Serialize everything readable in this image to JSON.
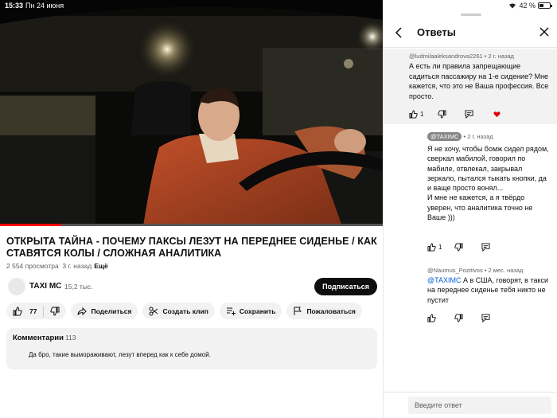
{
  "status": {
    "time": "15:33",
    "date": "Пн 24 июня",
    "battery_text": "42 %",
    "battery_level": 0.42
  },
  "video": {
    "progress": 0.16,
    "title": "ОТКРЫТА ТАЙНА - ПОЧЕМУ ПАКСЫ ЛЕЗУТ НА ПЕРЕДНЕЕ СИДЕНЬЕ / КАК СТАВЯТСЯ КОЛЫ / СЛОЖНАЯ АНАЛИТИКА",
    "views": "2 554 просмотра",
    "age": "3 г. назад",
    "more": "Ещё"
  },
  "channel": {
    "name": "TAXI MC",
    "subscribers": "15,2 тыс.",
    "subscribe_label": "Подписаться"
  },
  "actions": {
    "likes": "77",
    "share": "Поделиться",
    "clip": "Создать клип",
    "save": "Сохранить",
    "report": "Пожаловаться"
  },
  "comments": {
    "label": "Комментарии",
    "count": "113",
    "preview": "Да бро, такие вымораживают, лезут вперед как к себе домой."
  },
  "panel": {
    "title": "Ответы",
    "parent": {
      "author": "@ludmilaaleksandrova2261",
      "age": "2 г. назад",
      "text": "А есть ли правила запрещающие садиться пассажиру на 1-е сидение? Мне кажется, что это не Ваша профессия. Все просто.",
      "likes": "1"
    },
    "replies": [
      {
        "author": "@TAXIMC",
        "age": "2 г. назад",
        "text": "Я не хочу, чтобы бомж сидел рядом, сверкал мабилой, говорил по мабиле, отвлекал, закрывал зеркало, пытался тыкать кнопки, да и ваще просто вонял...\nИ мне не кажется, а я твёрдо уверен, что аналитика точно не Ваше )))",
        "likes": "1"
      },
      {
        "author": "@Naumus_Pozitivos",
        "age": "2 мес. назад",
        "mention": "@TAXIMC",
        "text": " А в США, говорят, в такси на переднее сиденье тебя никто не пустит"
      }
    ],
    "input_placeholder": "Введите ответ"
  },
  "colors": {
    "accent_red": "#ff0000",
    "heart": "#e00000",
    "link_blue": "#065fd4",
    "subscribe_bg": "#0f0f0f"
  }
}
